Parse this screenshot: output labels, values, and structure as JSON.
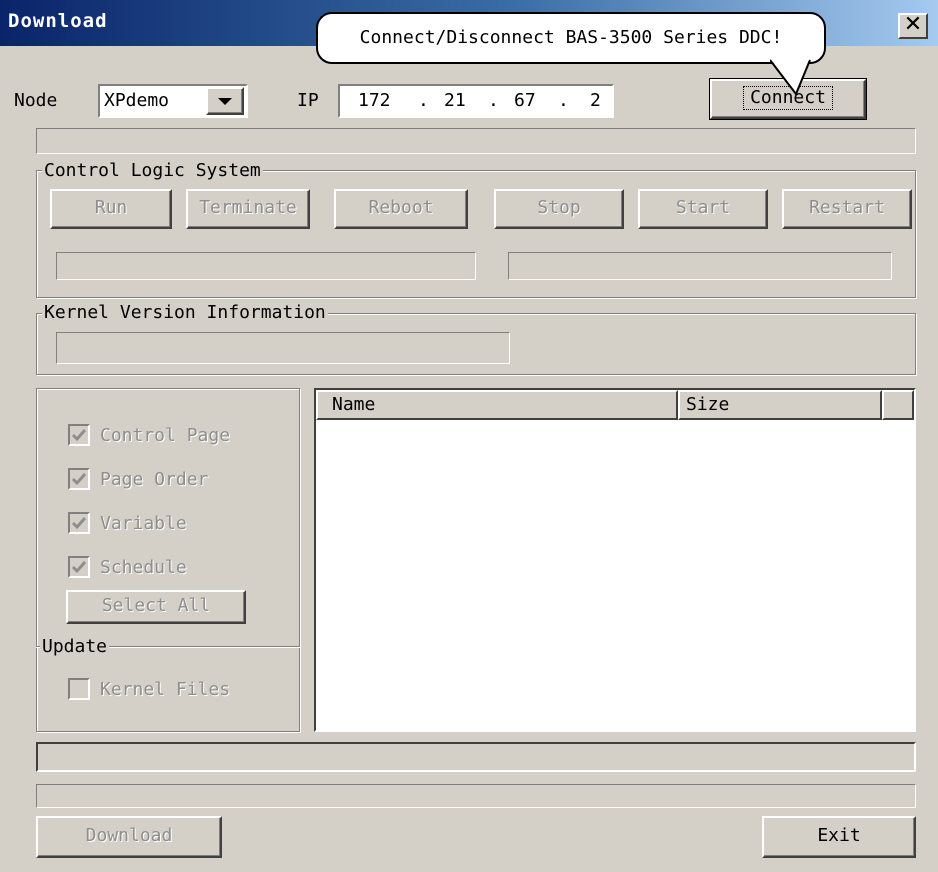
{
  "window": {
    "title": "Download",
    "close_glyph": "✕"
  },
  "tooltip": {
    "text": "Connect/Disconnect BAS-3500 Series DDC!"
  },
  "connection": {
    "node_label": "Node",
    "node_value": "XPdemo",
    "ip_label": "IP",
    "ip_octets": [
      "172",
      "21",
      "67",
      "2"
    ],
    "ip_separator": ".",
    "connect_button": "Connect"
  },
  "control_logic": {
    "group_title": "Control Logic System",
    "buttons": {
      "run": "Run",
      "terminate": "Terminate",
      "reboot": "Reboot",
      "stop": "Stop",
      "start": "Start",
      "restart": "Restart"
    }
  },
  "kernel": {
    "group_title": "Kernel Version Information"
  },
  "options": {
    "checkboxes": [
      {
        "label": "Control Page",
        "checked": true
      },
      {
        "label": "Page Order",
        "checked": true
      },
      {
        "label": "Variable",
        "checked": true
      },
      {
        "label": "Schedule",
        "checked": true
      }
    ],
    "select_all": "Select All",
    "update_title": "Update",
    "kernel_files": {
      "label": "Kernel Files",
      "checked": false
    }
  },
  "file_list": {
    "columns": [
      "Name",
      "Size"
    ]
  },
  "footer": {
    "download_button": "Download",
    "exit_button": "Exit"
  }
}
